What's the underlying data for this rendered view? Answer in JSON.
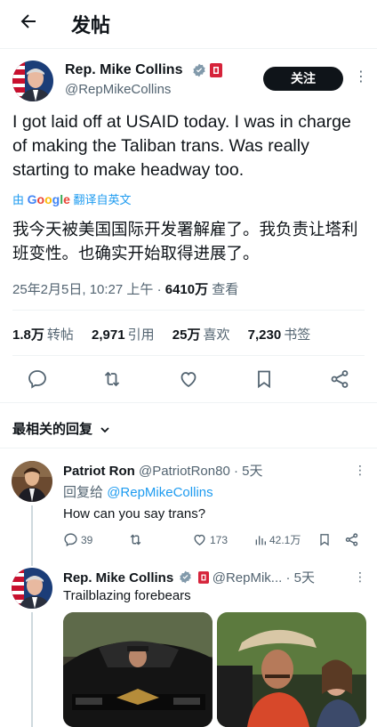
{
  "header": {
    "title": "发帖"
  },
  "tweet": {
    "name": "Rep. Mike Collins",
    "handle": "@RepMikeCollins",
    "follow_label": "关注",
    "text_en": "I got laid off at USAID today. I was in charge of making the Taliban trans. Was really starting to make headway too.",
    "translate_prefix": "由",
    "translate_brand": "Google",
    "translate_suffix": "翻译自英文",
    "text_cn": "我今天被美国国际开发署解雇了。我负责让塔利班变性。也确实开始取得进展了。",
    "datetime": "25年2月5日, 10:27 上午 · ",
    "views_count": "6410万",
    "views_label": " 查看",
    "stats": {
      "retweets_count": "1.8万",
      "retweets_label": "转帖",
      "quotes_count": "2,971",
      "quotes_label": "引用",
      "likes_count": "25万",
      "likes_label": "喜欢",
      "bookmarks_count": "7,230",
      "bookmarks_label": "书签"
    }
  },
  "replies_sort": {
    "label": "最相关的回复"
  },
  "replies": [
    {
      "name": "Patriot Ron",
      "handle": "@PatriotRon80",
      "time": "· 5天",
      "reply_to_label": "回复给",
      "reply_to_handle": "@RepMikeCollins",
      "text": "How can you say trans?",
      "reply_count": "39",
      "like_count": "173",
      "view_count": "42.1万"
    },
    {
      "name": "Rep. Mike Collins",
      "handle": "@RepMik...",
      "time": "· 5天",
      "text": "Trailblazing forebears"
    }
  ],
  "colors": {
    "accent": "#1d9bf0",
    "text": "#0f1419",
    "muted": "#536471",
    "verified": "#829aab",
    "flag": "#d6233a"
  }
}
